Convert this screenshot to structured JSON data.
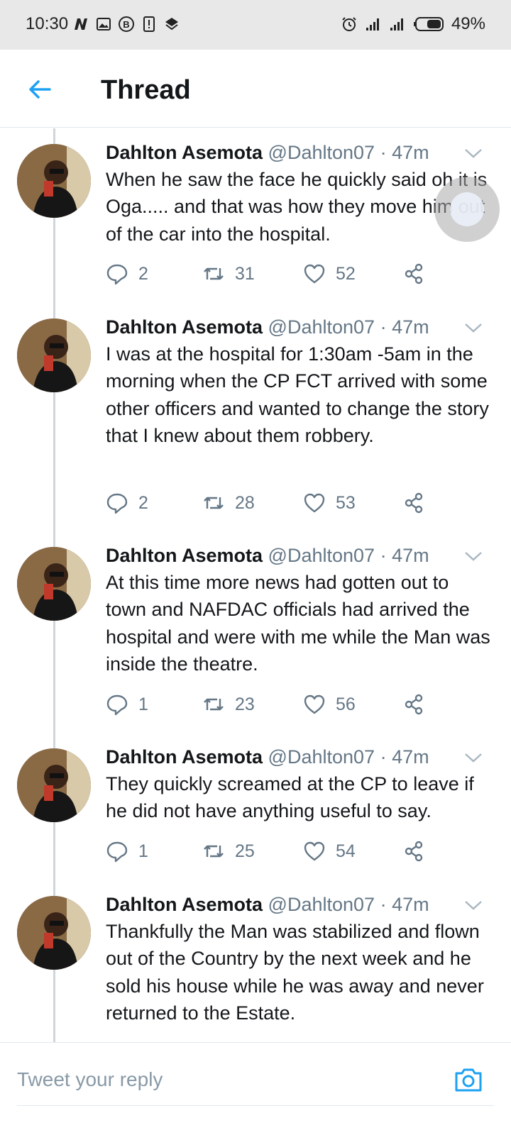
{
  "status_bar": {
    "time": "10:30",
    "battery": "49%",
    "icons_left": [
      "n-icon",
      "image-icon",
      "b-circle-icon",
      "sim-alert-icon",
      "layers-icon"
    ],
    "icons_right": [
      "alarm-icon",
      "signal-icon",
      "signal-icon",
      "battery-icon"
    ]
  },
  "header": {
    "title": "Thread",
    "back_icon": "arrow-left-icon",
    "accent": "#1da1f2"
  },
  "tweets": [
    {
      "name": "Dahlton Asemota",
      "handle": "@Dahlton07",
      "sep": "·",
      "time": "47m",
      "text": "When he saw the face he quickly said oh it is Oga..... and that was how they move him out of the car into the hospital.",
      "replies": "2",
      "retweets": "31",
      "likes": "52"
    },
    {
      "name": "Dahlton Asemota",
      "handle": "@Dahlton07",
      "sep": "·",
      "time": "47m",
      "text": "I was at the hospital for 1:30am -5am in the morning when the CP FCT arrived with some other officers and wanted to change the story that I knew about them robbery.",
      "replies": "2",
      "retweets": "28",
      "likes": "53"
    },
    {
      "name": "Dahlton Asemota",
      "handle": "@Dahlton07",
      "sep": "·",
      "time": "47m",
      "text": "At this time more news had gotten out to town and NAFDAC officials had arrived the hospital and were with me while the Man was inside the theatre.",
      "replies": "1",
      "retweets": "23",
      "likes": "56"
    },
    {
      "name": "Dahlton Asemota",
      "handle": "@Dahlton07",
      "sep": "·",
      "time": "47m",
      "text": "They quickly screamed at the CP to leave if he did not have anything useful to say.",
      "replies": "1",
      "retweets": "25",
      "likes": "54"
    },
    {
      "name": "Dahlton Asemota",
      "handle": "@Dahlton07",
      "sep": "·",
      "time": "47m",
      "text": "Thankfully the Man was stabilized and flown out of the Country by the next week and he sold his house while he was away and never returned to the Estate."
    }
  ],
  "reply_bar": {
    "placeholder": "Tweet your reply",
    "camera_icon": "camera-icon"
  }
}
